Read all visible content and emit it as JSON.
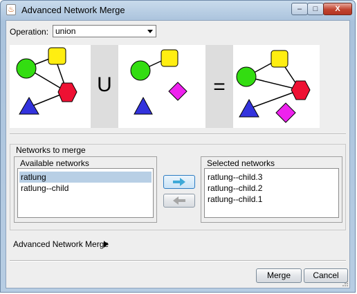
{
  "window": {
    "title": "Advanced Network Merge",
    "app_icon": "java-cup-icon",
    "controls": {
      "minimize": "–",
      "maximize": "□",
      "close": "X"
    }
  },
  "operation": {
    "label": "Operation:",
    "selected": "union"
  },
  "illustration": {
    "operator_symbol": "U",
    "equals_symbol": "=",
    "colors": {
      "circle": "#33dd11",
      "square": "#ffee11",
      "hexagon": "#ee1133",
      "triangle": "#3333dd",
      "diamond": "#ee22ee",
      "operator_bg": "#dddddd"
    }
  },
  "networks_group": {
    "title": "Networks to merge",
    "available": {
      "title": "Available networks",
      "items": [
        "ratlung",
        "ratlung--child"
      ],
      "selected_index": 0
    },
    "selected": {
      "title": "Selected networks",
      "items": [
        "ratlung--child.3",
        "ratlung--child.2",
        "ratlung--child.1"
      ]
    },
    "add_button_icon": "arrow-right-icon",
    "remove_button_icon": "arrow-left-icon"
  },
  "advanced": {
    "label": "Advanced Network Merge"
  },
  "buttons": {
    "merge": "Merge",
    "cancel": "Cancel"
  }
}
